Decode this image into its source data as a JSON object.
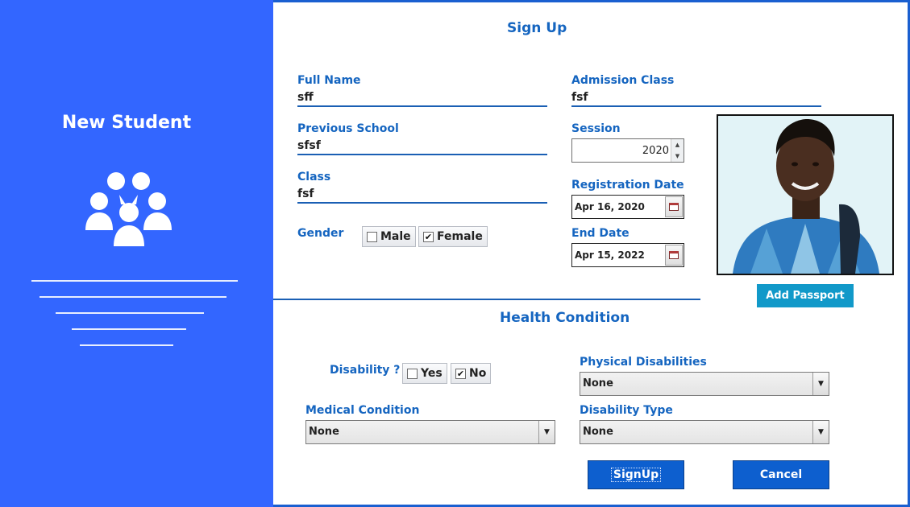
{
  "sidebar": {
    "title": "New Student",
    "icon": "group-icon"
  },
  "form": {
    "title": "Sign Up",
    "full_name": {
      "label": "Full Name",
      "value": "sff"
    },
    "previous_school": {
      "label": "Previous School",
      "value": "sfsf"
    },
    "class": {
      "label": "Class",
      "value": "fsf"
    },
    "gender": {
      "label": "Gender",
      "options": [
        {
          "label": "Male",
          "checked": false
        },
        {
          "label": "Female",
          "checked": true
        }
      ]
    },
    "admission_class": {
      "label": "Admission Class",
      "value": "fsf"
    },
    "session": {
      "label": "Session",
      "value": "2020"
    },
    "registration_date": {
      "label": "Registration Date",
      "value": "Apr 16, 2020"
    },
    "end_date": {
      "label": "End Date",
      "value": "Apr 15, 2022"
    },
    "add_passport_label": "Add Passport"
  },
  "health": {
    "title": "Health Condition",
    "disability": {
      "label": "Disability ?",
      "options": [
        {
          "label": "Yes",
          "checked": false
        },
        {
          "label": "No",
          "checked": true
        }
      ]
    },
    "physical_disabilities": {
      "label": "Physical Disabilities",
      "value": "None"
    },
    "medical_condition": {
      "label": "Medical Condition",
      "value": "None"
    },
    "disability_type": {
      "label": "Disability Type",
      "value": "None"
    }
  },
  "actions": {
    "signup_label": "SignUp",
    "cancel_label": "Cancel"
  },
  "colors": {
    "sidebar_bg": "#3366ff",
    "accent": "#1565c0",
    "button": "#0d5fcf",
    "passport_button": "#1199c9"
  }
}
